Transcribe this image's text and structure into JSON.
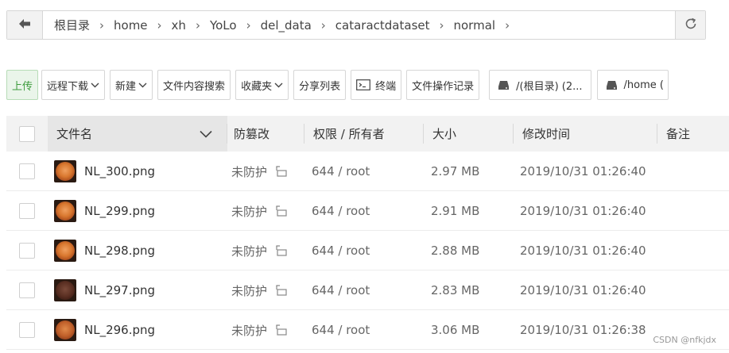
{
  "breadcrumb": {
    "items": [
      "根目录",
      "home",
      "xh",
      "YoLo",
      "del_data",
      "cataractdataset",
      "normal"
    ],
    "back_icon": "arrow-left-icon",
    "refresh_icon": "refresh-icon"
  },
  "toolbar": {
    "upload": "上传",
    "remote_download": "远程下载",
    "new": "新建",
    "content_search": "文件内容搜索",
    "favorites": "收藏夹",
    "share_list": "分享列表",
    "terminal": "终端",
    "file_log": "文件操作记录",
    "path_root": "/(根目录) (2...",
    "path_home": "/home ("
  },
  "table": {
    "headers": {
      "name": "文件名",
      "tamper": "防篡改",
      "perm_owner": "权限 / 所有者",
      "size": "大小",
      "mtime": "修改时间",
      "note": "备注"
    },
    "rows": [
      {
        "name": "NL_300.png",
        "tamper": "未防护",
        "perm": "644 / root",
        "size": "2.97 MB",
        "mtime": "2019/10/31 01:26:40"
      },
      {
        "name": "NL_299.png",
        "tamper": "未防护",
        "perm": "644 / root",
        "size": "2.91 MB",
        "mtime": "2019/10/31 01:26:40"
      },
      {
        "name": "NL_298.png",
        "tamper": "未防护",
        "perm": "644 / root",
        "size": "2.88 MB",
        "mtime": "2019/10/31 01:26:40"
      },
      {
        "name": "NL_297.png",
        "tamper": "未防护",
        "perm": "644 / root",
        "size": "2.83 MB",
        "mtime": "2019/10/31 01:26:40"
      },
      {
        "name": "NL_296.png",
        "tamper": "未防护",
        "perm": "644 / root",
        "size": "3.06 MB",
        "mtime": "2019/10/31 01:26:38"
      }
    ]
  },
  "watermark": "CSDN @nfkjdx",
  "colors": {
    "upload_green": "#3c9b3c",
    "header_bg": "#f2f2f2",
    "border": "#d6d6d6"
  }
}
